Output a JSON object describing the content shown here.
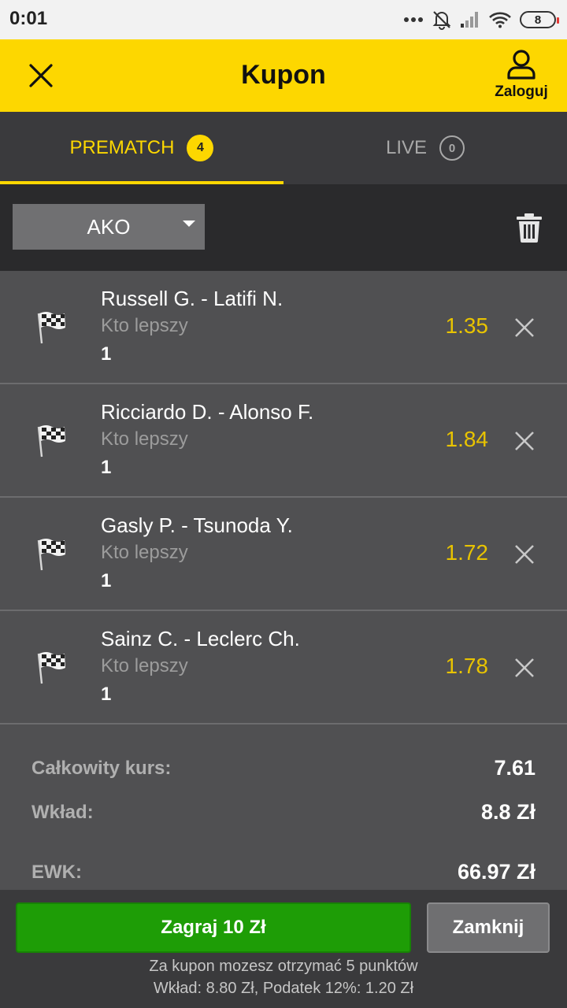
{
  "status_bar": {
    "time": "0:01",
    "battery": "8"
  },
  "header": {
    "title": "Kupon",
    "login_label": "Zaloguj"
  },
  "tabs": [
    {
      "label": "PREMATCH",
      "count": "4",
      "active": true
    },
    {
      "label": "LIVE",
      "count": "0",
      "active": false
    }
  ],
  "bet_type": {
    "selected": "AKO"
  },
  "bets": [
    {
      "match": "Russell G. - Latifi N.",
      "market": "Kto lepszy",
      "pick": "1",
      "odds": "1.35"
    },
    {
      "match": "Ricciardo D. - Alonso F.",
      "market": "Kto lepszy",
      "pick": "1",
      "odds": "1.84"
    },
    {
      "match": "Gasly P. - Tsunoda Y.",
      "market": "Kto lepszy",
      "pick": "1",
      "odds": "1.72"
    },
    {
      "match": "Sainz C. - Leclerc Ch.",
      "market": "Kto lepszy",
      "pick": "1",
      "odds": "1.78"
    }
  ],
  "summary": {
    "total_odds_label": "Całkowity kurs:",
    "total_odds_value": "7.61",
    "stake_label": "Wkład:",
    "stake_value": "8.8 Zł",
    "ewk_label": "EWK:",
    "ewk_value": "66.97 Zł"
  },
  "footer": {
    "play_label": "Zagraj 10 Zł",
    "close_label": "Zamknij",
    "points_note": "Za kupon mozesz otrzymać 5 punktów",
    "tax_note": "Wkład: 8.80 Zł, Podatek 12%: 1.20 Zł"
  },
  "colors": {
    "accent": "#fdd700",
    "odds": "#e8c300",
    "play_button": "#1e9d06"
  }
}
